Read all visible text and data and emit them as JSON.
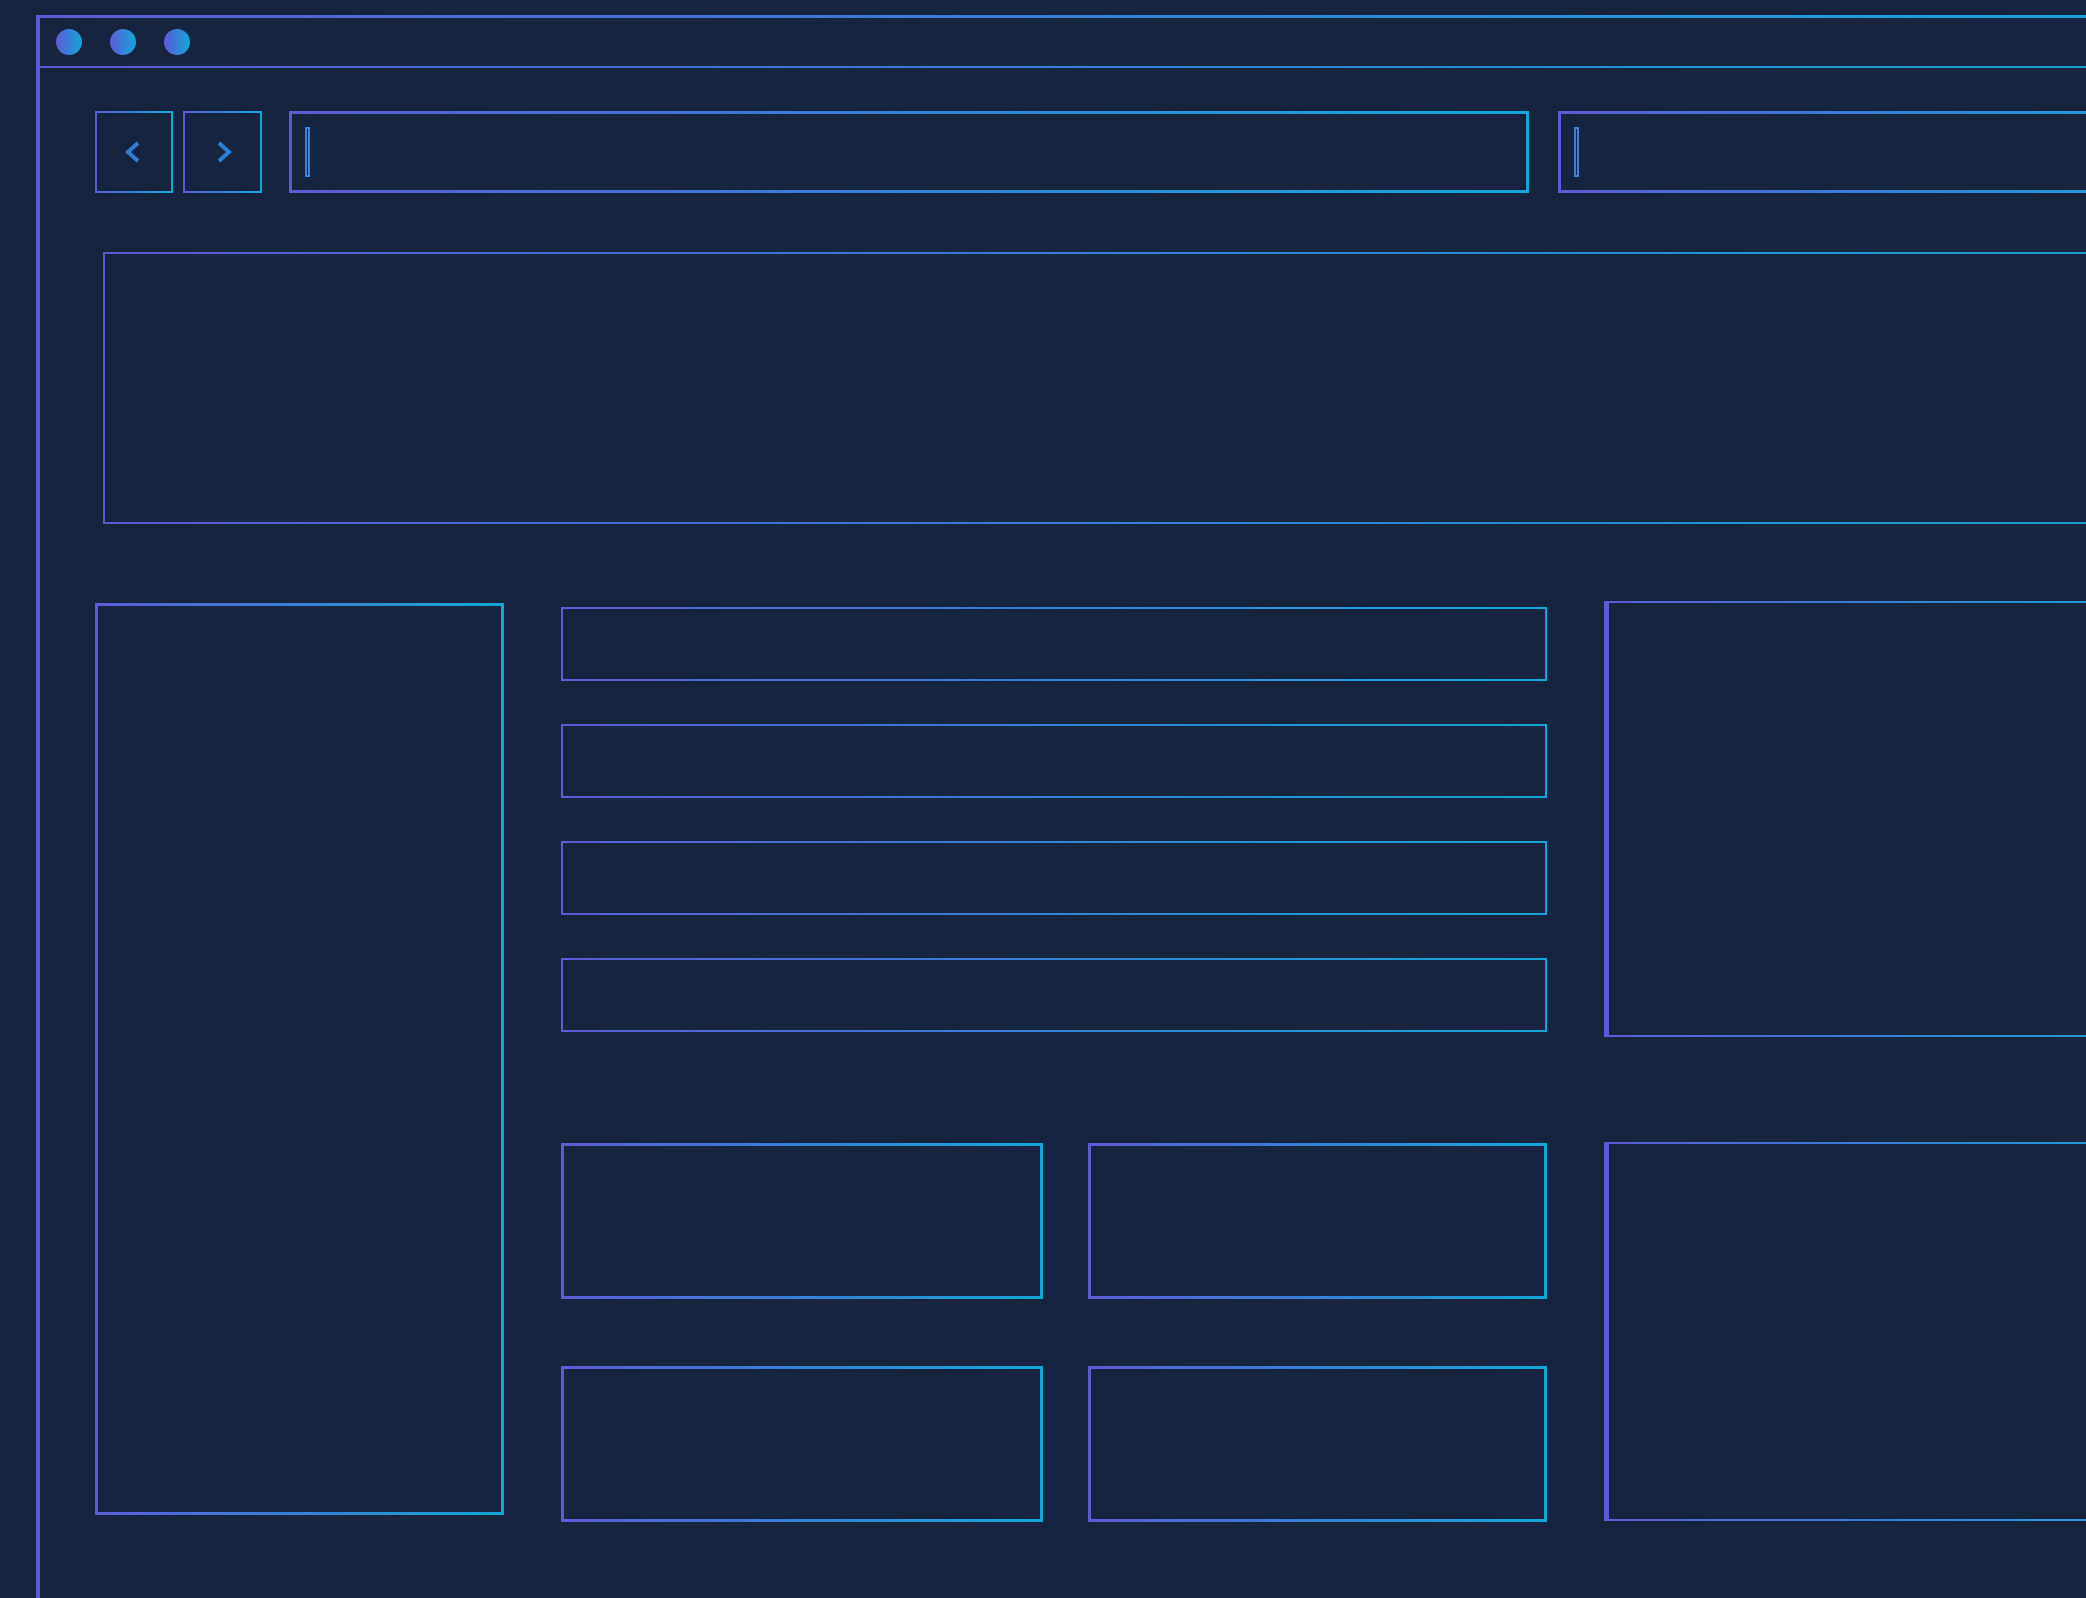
{
  "window": {
    "controls": [
      {
        "kind": "dot"
      },
      {
        "kind": "dot"
      },
      {
        "kind": "dot"
      }
    ]
  },
  "toolbar": {
    "nav_buttons": [
      {
        "kind": "back"
      },
      {
        "kind": "forward"
      }
    ],
    "fields": [
      {
        "kind": "address"
      },
      {
        "kind": "search"
      }
    ]
  },
  "banner": {
    "kind": "panel"
  },
  "sidebar": {
    "kind": "panel"
  },
  "list_rows": [
    {
      "kind": "row"
    },
    {
      "kind": "row"
    },
    {
      "kind": "row"
    },
    {
      "kind": "row"
    }
  ],
  "cards": [
    {
      "kind": "card"
    },
    {
      "kind": "card"
    },
    {
      "kind": "card"
    },
    {
      "kind": "card"
    }
  ],
  "side_panels": [
    {
      "kind": "panel"
    },
    {
      "kind": "panel"
    }
  ]
}
